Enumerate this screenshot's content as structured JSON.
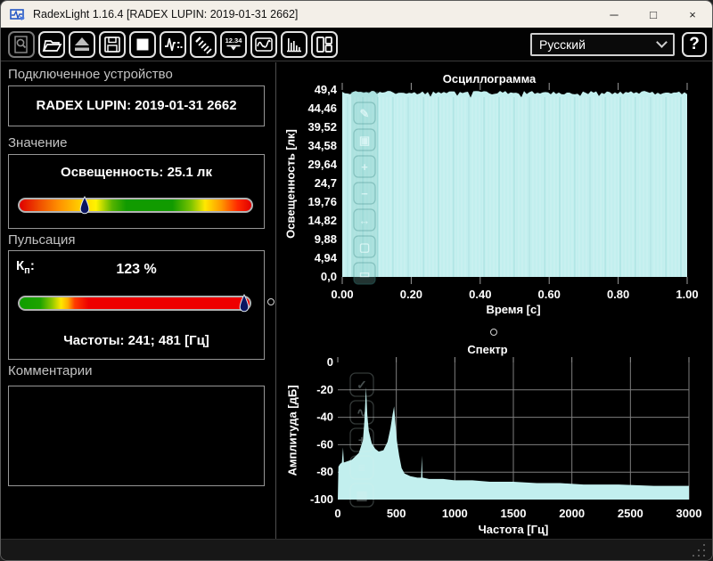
{
  "window": {
    "title": "RadexLight 1.16.4 [RADEX LUPIN: 2019-01-31 2662]",
    "controls": {
      "minimize": "─",
      "maximize": "□",
      "close": "×"
    }
  },
  "toolbar": {
    "buttons": [
      {
        "icon": "search-device-icon",
        "enabled": false
      },
      {
        "icon": "open-folder-icon",
        "enabled": true
      },
      {
        "icon": "eject-icon",
        "enabled": true
      },
      {
        "icon": "save-icon",
        "enabled": true
      },
      {
        "icon": "stop-icon",
        "enabled": true
      },
      {
        "icon": "pulse-measure-icon",
        "enabled": true
      },
      {
        "icon": "brush-icon",
        "enabled": true
      },
      {
        "icon": "digital-display-icon",
        "enabled": true
      },
      {
        "icon": "oscillogram-icon",
        "enabled": true
      },
      {
        "icon": "spectrum-icon",
        "enabled": true
      },
      {
        "icon": "layout-panels-icon",
        "enabled": true
      }
    ],
    "digital_icon_text": "12.34",
    "language": "Русский",
    "help_label": "?"
  },
  "device_section": {
    "header": "Подключенное устройство",
    "value": "RADEX LUPIN: 2019-01-31 2662"
  },
  "value_section": {
    "header": "Значение",
    "reading": "Освещенность: 25.1 лк",
    "marker_pos": 0.28
  },
  "pulsation_section": {
    "header": "Пульсация",
    "kp_main": "К",
    "kp_sub": "п",
    "kp_colon": ":",
    "kp_value": "123 %",
    "frequencies": "Частоты: 241; 481 [Гц]",
    "marker_pos": 0.975
  },
  "comments_section": {
    "header": "Комментарии",
    "text": ""
  },
  "charts": {
    "accent_fill": "#c2efee",
    "grid_color": "#7e7e7e",
    "osc_ghost_icons": [
      "pencil-icon",
      "image-icon",
      "zoom-in-icon",
      "zoom-out-icon",
      "pan-icon",
      "fit-icon",
      "ratio-icon"
    ],
    "spec_ghost_icons": [
      "check-icon",
      "wave-icon",
      "zoom-in-icon",
      "list-icon",
      "grid-icon"
    ]
  },
  "chart_data": [
    {
      "type": "area",
      "name": "oscillogram",
      "title": "Осциллограмма",
      "xlabel": "Время [с]",
      "ylabel": "Освещенность [лк]",
      "xlim": [
        0,
        1
      ],
      "ylim": [
        0,
        49.4
      ],
      "xticks": [
        "0.00",
        "0.20",
        "0.40",
        "0.60",
        "0.80",
        "1.00"
      ],
      "yticks": [
        "49,4",
        "44,46",
        "39,52",
        "34,58",
        "29,64",
        "24,7",
        "19,76",
        "14,82",
        "9,88",
        "4,94",
        "0,0"
      ],
      "grid": false,
      "description": "Dense flicker waveform oscillating between 0 and ~49.4 lx over the whole 1 s window, rendered as a solid fill"
    },
    {
      "type": "area",
      "name": "spectrum",
      "title": "Спектр",
      "xlabel": "Частота [Гц]",
      "ylabel": "Амплитуда [дБ]",
      "xlim": [
        0,
        3000
      ],
      "ylim": [
        -100,
        0
      ],
      "xticks": [
        "0",
        "500",
        "1000",
        "1500",
        "2000",
        "2500",
        "3000"
      ],
      "yticks": [
        "0",
        "-20",
        "-40",
        "-60",
        "-80",
        "-100"
      ],
      "grid": true,
      "peaks_hz": [
        241,
        481
      ],
      "points": [
        [
          0,
          -100
        ],
        [
          5,
          -76
        ],
        [
          20,
          -74
        ],
        [
          35,
          -73
        ],
        [
          45,
          -62
        ],
        [
          52,
          -73
        ],
        [
          120,
          -71
        ],
        [
          180,
          -66
        ],
        [
          215,
          -57
        ],
        [
          228,
          -42
        ],
        [
          241,
          -18
        ],
        [
          252,
          -38
        ],
        [
          265,
          -50
        ],
        [
          290,
          -59
        ],
        [
          320,
          -63
        ],
        [
          350,
          -65
        ],
        [
          390,
          -64
        ],
        [
          425,
          -58
        ],
        [
          450,
          -48
        ],
        [
          468,
          -38
        ],
        [
          481,
          -32
        ],
        [
          492,
          -44
        ],
        [
          505,
          -57
        ],
        [
          525,
          -68
        ],
        [
          545,
          -77
        ],
        [
          570,
          -81
        ],
        [
          620,
          -83
        ],
        [
          680,
          -84
        ],
        [
          712,
          -84
        ],
        [
          718,
          -68
        ],
        [
          724,
          -84
        ],
        [
          780,
          -85
        ],
        [
          900,
          -85
        ],
        [
          1000,
          -86
        ],
        [
          1150,
          -86
        ],
        [
          1300,
          -87
        ],
        [
          1500,
          -87
        ],
        [
          1700,
          -88
        ],
        [
          1900,
          -88
        ],
        [
          2100,
          -89
        ],
        [
          2400,
          -89
        ],
        [
          2700,
          -90
        ],
        [
          3000,
          -90
        ]
      ]
    }
  ]
}
